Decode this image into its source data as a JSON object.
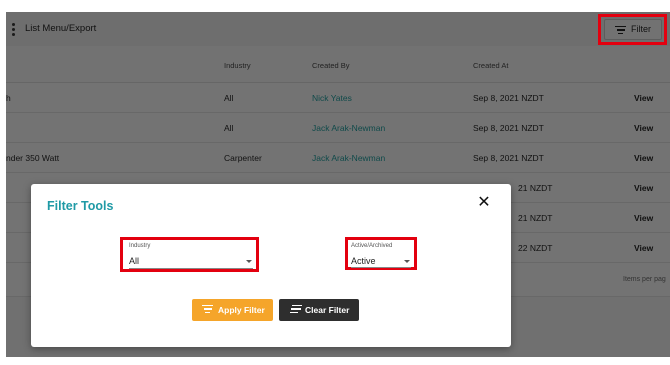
{
  "toolbar": {
    "menu_label": "List Menu/Export",
    "filter_label": "Filter"
  },
  "table": {
    "headers": {
      "industry": "Industry",
      "created_by": "Created By",
      "created_at": "Created At"
    },
    "rows": [
      {
        "name": "h",
        "industry": "All",
        "created_by": "Nick Yates",
        "created_at": "Sep 8, 2021 NZDT",
        "action": "View"
      },
      {
        "name": "",
        "industry": "All",
        "created_by": "Jack Arak-Newman",
        "created_at": "Sep 8, 2021 NZDT",
        "action": "View"
      },
      {
        "name": "nder 350 Watt",
        "industry": "Carpenter",
        "created_by": "Jack Arak-Newman",
        "created_at": "Sep 8, 2021 NZDT",
        "action": "View"
      },
      {
        "name": "",
        "industry": "",
        "created_by": "",
        "created_at": "21 NZDT",
        "action": "View"
      },
      {
        "name": "",
        "industry": "",
        "created_by": "",
        "created_at": "21 NZDT",
        "action": "View"
      },
      {
        "name": "",
        "industry": "",
        "created_by": "",
        "created_at": "22 NZDT",
        "action": "View"
      }
    ],
    "footer_text": "Items per pag"
  },
  "filter_modal": {
    "title": "Filter Tools",
    "close_icon": "close-icon",
    "industry": {
      "label": "Industry",
      "value": "All"
    },
    "status": {
      "label": "Active/Archived",
      "value": "Active"
    },
    "apply_label": "Apply Filter",
    "clear_label": "Clear Filter"
  },
  "colors": {
    "accent": "#1f9aa6",
    "apply_button": "#f5a52a",
    "clear_button": "#2e2e2e",
    "highlight": "#e3000f"
  }
}
